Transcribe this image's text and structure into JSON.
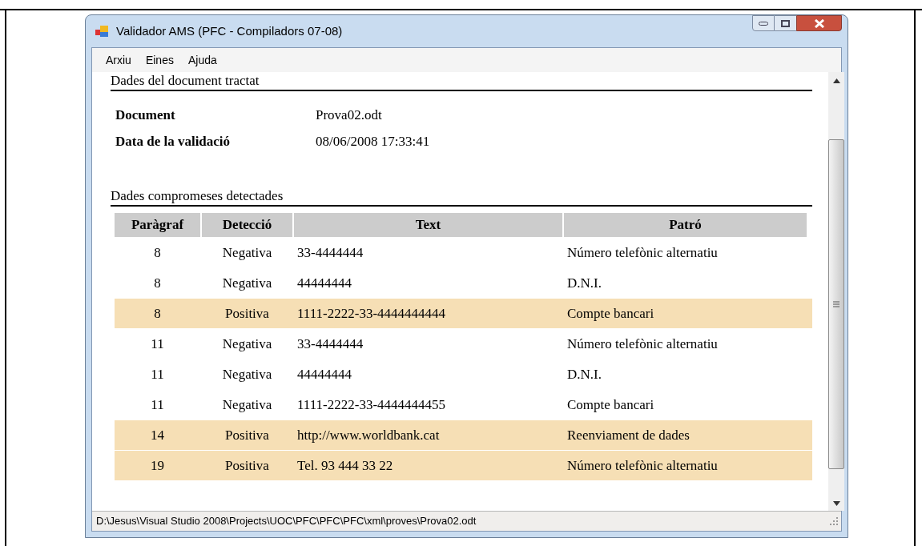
{
  "window": {
    "title": "Validador AMS (PFC - Compiladors 07-08)"
  },
  "menu": [
    "Arxiu",
    "Eines",
    "Ajuda"
  ],
  "document_section": {
    "heading": "Dades del document tractat",
    "fields": [
      {
        "label": "Document",
        "value": "Prova02.odt"
      },
      {
        "label": "Data de la validació",
        "value": "08/06/2008 17:33:41"
      }
    ]
  },
  "detections_section": {
    "heading": "Dades compromeses detectades",
    "table": {
      "columns": [
        "Paràgraf",
        "Detecció",
        "Text",
        "Patró"
      ],
      "rows": [
        {
          "cells": [
            "8",
            "Negativa",
            "33-4444444",
            "Número telefònic alternatiu"
          ],
          "highlighted": false
        },
        {
          "cells": [
            "8",
            "Negativa",
            "44444444",
            "D.N.I."
          ],
          "highlighted": false
        },
        {
          "cells": [
            "8",
            "Positiva",
            "1111-2222-33-4444444444",
            "Compte bancari"
          ],
          "highlighted": true
        },
        {
          "cells": [
            "11",
            "Negativa",
            "33-4444444",
            "Número telefònic alternatiu"
          ],
          "highlighted": false
        },
        {
          "cells": [
            "11",
            "Negativa",
            "44444444",
            "D.N.I."
          ],
          "highlighted": false
        },
        {
          "cells": [
            "11",
            "Negativa",
            "1111-2222-33-4444444455",
            "Compte bancari"
          ],
          "highlighted": false
        },
        {
          "cells": [
            "14",
            "Positiva",
            "http://www.worldbank.cat",
            "Reenviament de dades"
          ],
          "highlighted": true
        },
        {
          "cells": [
            "19",
            "Positiva",
            "Tel. 93 444 33 22",
            "Número telefònic alternatiu"
          ],
          "highlighted": true
        }
      ]
    }
  },
  "status_bar": "D:\\Jesus\\Visual Studio 2008\\Projects\\UOC\\PFC\\PFC\\PFC\\xml\\proves\\Prova02.odt"
}
